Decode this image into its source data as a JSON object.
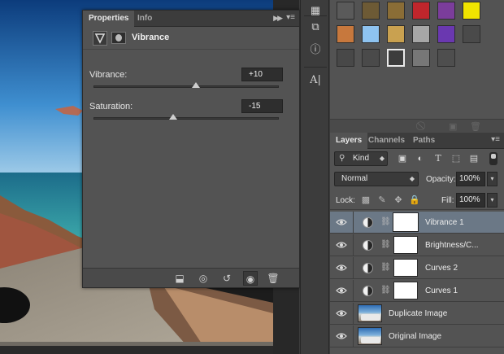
{
  "properties_panel": {
    "tabs": [
      {
        "label": "Properties",
        "active": true
      },
      {
        "label": "Info",
        "active": false
      }
    ],
    "adjustment_title": "Vibrance",
    "sliders": [
      {
        "label": "Vibrance:",
        "value": "+10"
      },
      {
        "label": "Saturation:",
        "value": "-15"
      }
    ],
    "footer_icons": [
      "clip-to-layer-icon",
      "view-previous-state-icon",
      "reset-adjustments-icon",
      "toggle-visibility-icon",
      "trash-icon"
    ]
  },
  "tool_column_icons": [
    "swatches-icon",
    "3d-cube-icon",
    "info-icon",
    "character-icon"
  ],
  "styles_panel": {
    "swatch_colors": [
      "#5a5a5a",
      "#6d5a35",
      "#8a6d36",
      "#c0262c",
      "#7b3d9b",
      "#f0e400",
      "#c7783d",
      "#8ec3f0",
      "#c9a150",
      "#a7a7a7",
      "#6a38b0",
      "#4a4a4a",
      "#484848",
      "#4a4a4a",
      "#3c3c3c",
      "#777777",
      "#4e4e4e"
    ],
    "footer_icons": [
      "clear-style-icon",
      "new-style-icon",
      "delete-style-icon"
    ]
  },
  "layers_panel": {
    "tabs": [
      {
        "label": "Layers",
        "active": true
      },
      {
        "label": "Channels",
        "active": false
      },
      {
        "label": "Paths",
        "active": false
      }
    ],
    "kind_filter": "Kind",
    "blend_mode": "Normal",
    "opacity_label": "Opacity:",
    "opacity_value": "100%",
    "lock_label": "Lock:",
    "fill_label": "Fill:",
    "fill_value": "100%",
    "layers": [
      {
        "name": "Vibrance 1",
        "type": "adjustment",
        "selected": true,
        "visible": true
      },
      {
        "name": "Brightness/C...",
        "type": "adjustment",
        "selected": false,
        "visible": true
      },
      {
        "name": "Curves 2",
        "type": "adjustment",
        "selected": false,
        "visible": true
      },
      {
        "name": "Curves 1",
        "type": "adjustment",
        "selected": false,
        "visible": true
      },
      {
        "name": "Duplicate Image",
        "type": "image",
        "selected": false,
        "visible": true
      },
      {
        "name": "Original Image",
        "type": "image",
        "selected": false,
        "visible": true
      }
    ]
  }
}
